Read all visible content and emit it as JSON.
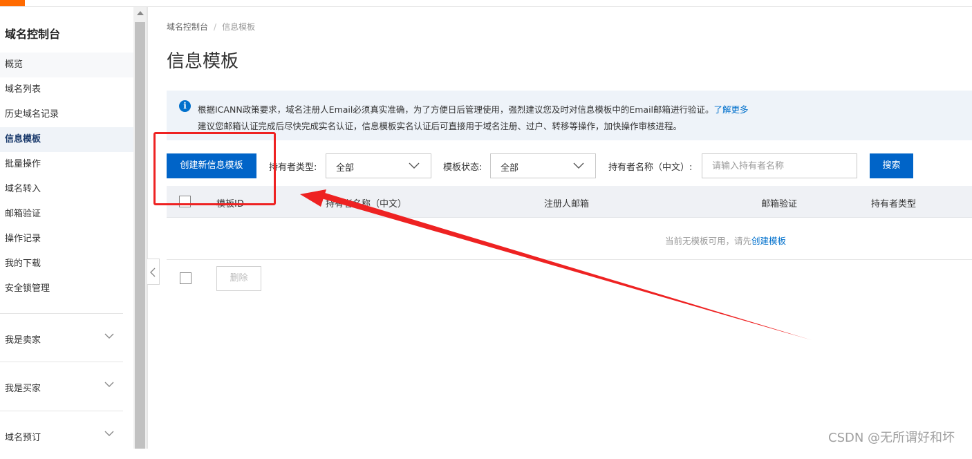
{
  "sidebar": {
    "title": "域名控制台",
    "items": [
      {
        "label": "概览"
      },
      {
        "label": "域名列表"
      },
      {
        "label": "历史域名记录"
      },
      {
        "label": "信息模板"
      },
      {
        "label": "批量操作"
      },
      {
        "label": "域名转入"
      },
      {
        "label": "邮箱验证"
      },
      {
        "label": "操作记录"
      },
      {
        "label": "我的下载"
      },
      {
        "label": "安全锁管理"
      }
    ],
    "groups": [
      {
        "label": "我是卖家"
      },
      {
        "label": "我是买家"
      },
      {
        "label": "域名预订"
      }
    ]
  },
  "breadcrumb": {
    "root": "域名控制台",
    "separator": "/",
    "current": "信息模板"
  },
  "page": {
    "title": "信息模板"
  },
  "notice": {
    "icon": "info-icon",
    "line1": "根据ICANN政策要求，域名注册人Email必须真实准确，为了方便日后管理使用，强烈建议您及时对信息模板中的Email邮箱进行验证。",
    "link": "了解更多",
    "line2": "建议您邮箱认证完成后尽快完成实名认证，信息模板实名认证后可直接用于域名注册、过户、转移等操作，加快操作审核进程。"
  },
  "toolbar": {
    "create_label": "创建新信息模板",
    "holder_type_label": "持有者类型:",
    "holder_type_value": "全部",
    "status_label": "模板状态:",
    "status_value": "全部",
    "holder_name_label": "持有者名称（中文）:",
    "holder_name_placeholder": "请输入持有者名称",
    "search_label": "搜索"
  },
  "table": {
    "columns": [
      "模板ID",
      "持有者名称（中文）",
      "注册人邮箱",
      "邮箱验证",
      "持有者类型"
    ],
    "empty_text": "当前无模板可用，请先",
    "empty_link": "创建模板"
  },
  "footer_actions": {
    "delete_label": "删除"
  },
  "watermark": "CSDN @无所谓好和坏",
  "colors": {
    "primary": "#0064c8",
    "accent": "#ff6a00",
    "annotation": "#ee2222",
    "notice_bg": "#eef3f9"
  }
}
